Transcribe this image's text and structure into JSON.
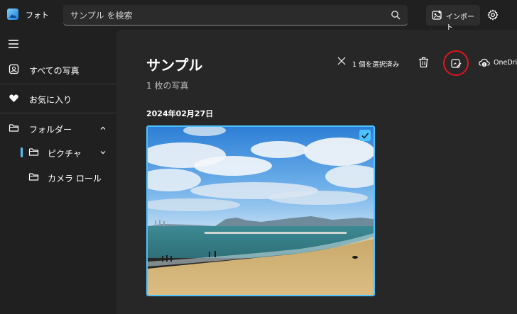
{
  "app": {
    "name": "フォト"
  },
  "search": {
    "placeholder": "サンプル を検索"
  },
  "header": {
    "import_label": "インポート"
  },
  "sidebar": {
    "items": [
      {
        "label": "すべての写真"
      },
      {
        "label": "お気に入り"
      },
      {
        "label": "フォルダー"
      },
      {
        "label": "ピクチャ"
      },
      {
        "label": "カメラ ロール"
      }
    ]
  },
  "main": {
    "title": "サンプル",
    "count": "1 枚の写真",
    "selection": "1 個を選択済み",
    "onedrive_label": "OneDrive",
    "date_header": "2024年02月27日"
  },
  "colors": {
    "accent": "#4cc2ff",
    "highlight_circle": "#e0141e",
    "background": "#202020",
    "content_background": "#272727"
  },
  "icons": [
    "app-photos-icon",
    "search-icon",
    "import-icon",
    "gear-icon",
    "hamburger-icon",
    "gallery-icon",
    "heart-icon",
    "folder-icon",
    "chevron-up-icon",
    "chevron-down-icon",
    "close-icon",
    "trash-icon",
    "edit-icon",
    "cloud-icon",
    "checkmark-icon"
  ]
}
